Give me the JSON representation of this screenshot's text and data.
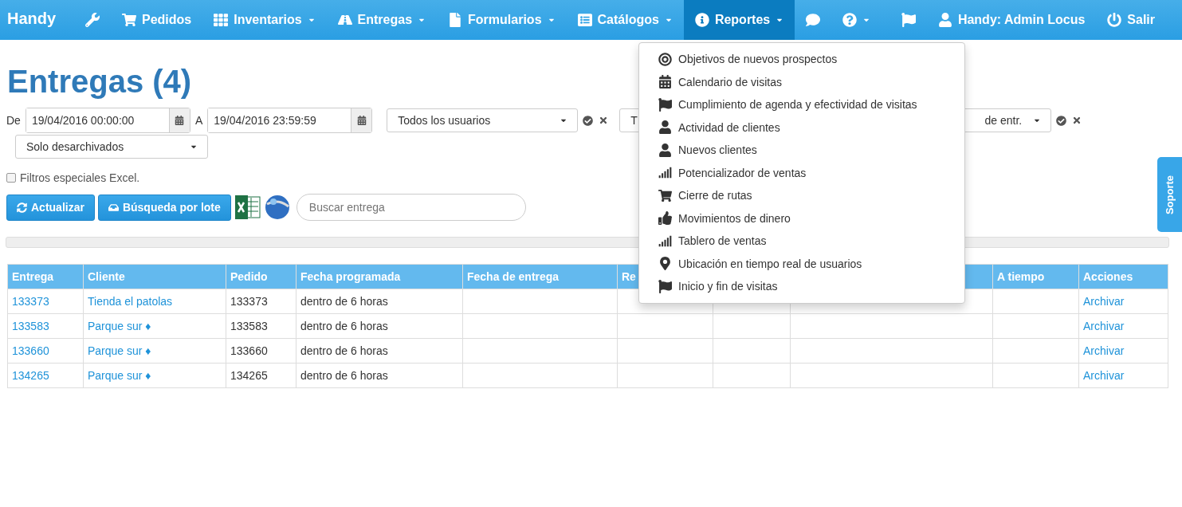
{
  "navbar": {
    "brand": "Handy",
    "items": [
      {
        "caret": false,
        "selected": false
      },
      {
        "label": "Pedidos",
        "caret": false,
        "selected": false
      },
      {
        "label": "Inventarios",
        "caret": true,
        "selected": false
      },
      {
        "label": "Entregas",
        "caret": true,
        "selected": false
      },
      {
        "label": "Formularios",
        "caret": true,
        "selected": false
      },
      {
        "label": "Catálogos",
        "caret": true,
        "selected": false
      },
      {
        "label": "Reportes",
        "caret": true,
        "selected": true
      },
      {
        "caret": false,
        "selected": false
      },
      {
        "caret": true,
        "selected": false
      }
    ],
    "right": [
      {
        "label": "Handy: Admin Locus"
      },
      {
        "label": "Salir"
      }
    ]
  },
  "title": "Entregas (4)",
  "filters": {
    "from_label": "De",
    "from_value": "19/04/2016 00:00:00",
    "to_label": "A",
    "to_value": "19/04/2016 23:59:59",
    "selects": [
      {
        "value": "Todos los usuarios",
        "actions": true
      },
      {
        "value": "T"
      },
      {
        "value": "de entr.",
        "actions": true
      }
    ],
    "archive_select": "Solo desarchivados",
    "excel_filters": {
      "label": "Filtros especiales Excel.",
      "checked": false
    }
  },
  "toolbar": {
    "buttons": [
      "Actualizar",
      "Búsqueda por lote"
    ],
    "search_placeholder": "Buscar entrega"
  },
  "progress": {
    "level": 0
  },
  "table": {
    "columns": [
      "Entrega",
      "Cliente",
      "Pedido",
      "Fecha programada",
      "Fecha de entrega",
      "Re",
      null,
      null,
      "A tiempo",
      "Acciones"
    ],
    "rows": [
      {
        "entrega": "133373",
        "cliente": "Tienda el patolas",
        "pedido": "133373",
        "fecha": "dentro de 6 horas",
        "accion": "Archivar"
      },
      {
        "entrega": "133583",
        "cliente": "Parque sur ♦",
        "pedido": "133583",
        "fecha": "dentro de 6 horas",
        "accion": "Archivar"
      },
      {
        "entrega": "133660",
        "cliente": "Parque sur ♦",
        "pedido": "133660",
        "fecha": "dentro de 6 horas",
        "accion": "Archivar"
      },
      {
        "entrega": "134265",
        "cliente": "Parque sur ♦",
        "pedido": "134265",
        "fecha": "dentro de 6 horas",
        "accion": "Archivar"
      }
    ]
  },
  "reports_menu": [
    "Objetivos de nuevos prospectos",
    "Calendario de visitas",
    "Cumplimiento de agenda y efectividad de visitas",
    "Actividad de clientes",
    "Nuevos clientes",
    "Potencializador de ventas",
    "Cierre de rutas",
    "Movimientos de dinero",
    "Tablero de ventas",
    "Ubicación en tiempo real de usuarios",
    "Inicio y fin de visitas"
  ],
  "support_tab": "Soporte"
}
